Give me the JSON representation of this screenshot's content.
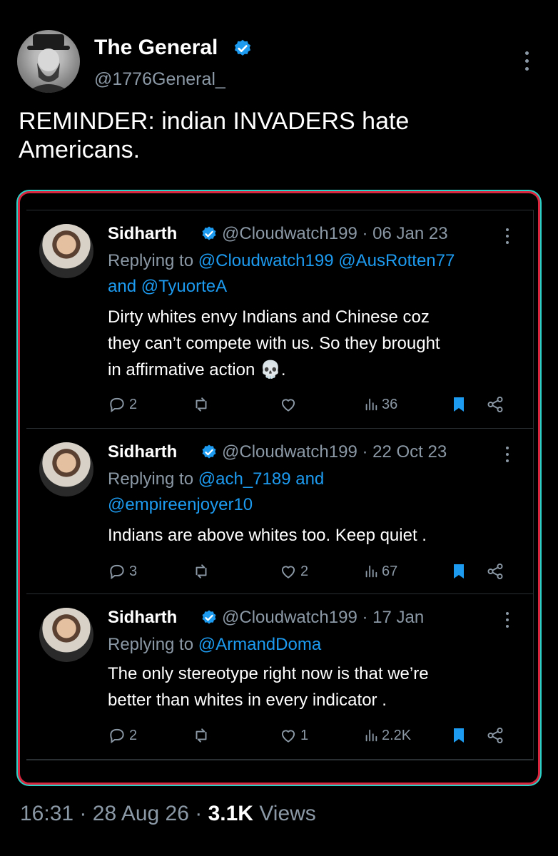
{
  "tweet": {
    "author_name": "The General",
    "author_handle": "@1776General_",
    "text_line1": "REMINDER: indian INVADERS hate",
    "text_line2": "Americans."
  },
  "replies": [
    {
      "name": "Sidharth",
      "handle_date": "@Cloudwatch199 · 06 Jan 23",
      "replying_prefix": "Replying to ",
      "replying_line1_mentions": "@Cloudwatch199 @AusRotten77",
      "replying_line2": "and @TyuorteA",
      "text_line1": "Dirty whites envy Indians and Chinese coz",
      "text_line2": "they can’t compete with us. So they brought",
      "text_line3": "in affirmative action 💀.",
      "replies_count": "2",
      "likes_count": "",
      "views_count": "36"
    },
    {
      "name": "Sidharth",
      "handle_date": "@Cloudwatch199 · 22 Oct 23",
      "replying_prefix": "Replying to ",
      "replying_line1_mentions": "@ach_7189 and",
      "replying_line2": "@empireenjoyer10",
      "text_line1": "Indians are above whites too. Keep quiet .",
      "replies_count": "3",
      "likes_count": "2",
      "views_count": "67"
    },
    {
      "name": "Sidharth",
      "handle_date": "@Cloudwatch199 · 17 Jan",
      "replying_prefix": "Replying to ",
      "replying_line1_mentions": "@ArmandDoma",
      "text_line1": "The only stereotype right now is that we’re",
      "text_line2": "better than whites in every indicator .",
      "replies_count": "2",
      "likes_count": "1",
      "views_count": "2.2K"
    }
  ],
  "footer": {
    "time": "16:31",
    "date": "28 Aug 26",
    "views_count": "3.1K",
    "views_label": "Views",
    "separator": "·"
  },
  "colors": {
    "background": "#000000",
    "text": "#e7e9ea",
    "muted": "#8b98a5",
    "link": "#1d9bf0",
    "bookmark": "#1d9bf0",
    "frame_red": "#d7263d",
    "frame_teal": "#2bd2c7"
  },
  "icons": [
    "verified-badge-icon",
    "reply-icon",
    "retweet-icon",
    "like-icon",
    "views-icon",
    "bookmark-icon",
    "share-icon",
    "more-icon"
  ]
}
